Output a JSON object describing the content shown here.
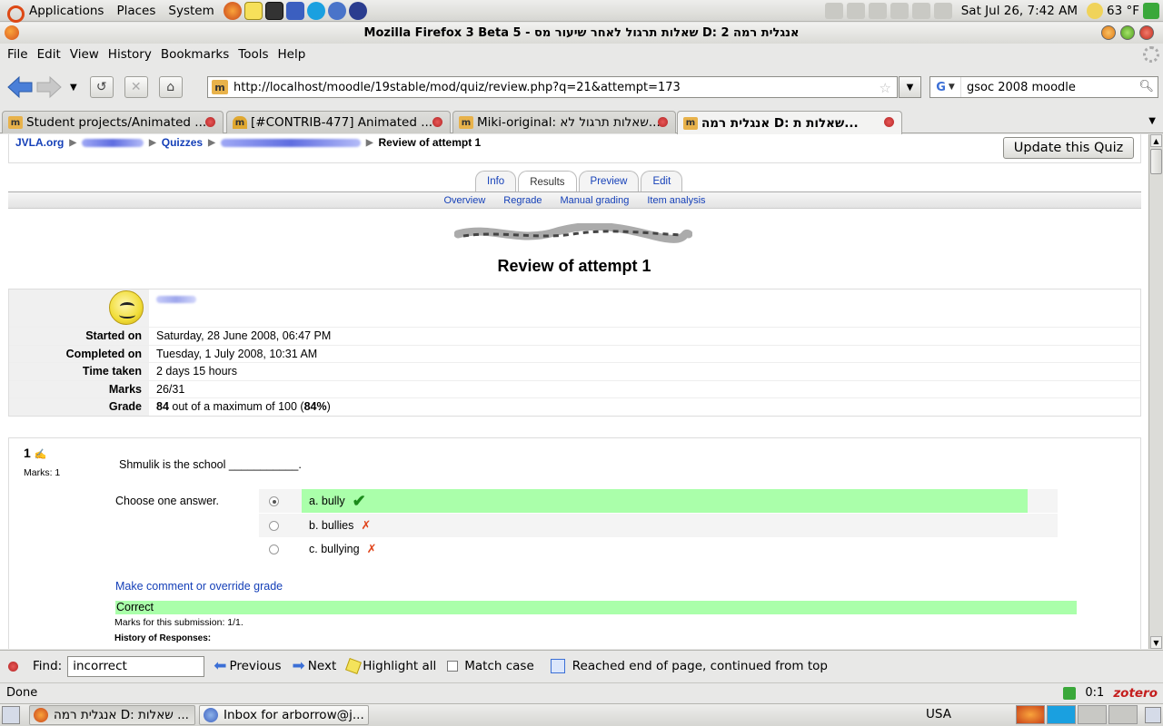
{
  "gnome_panel": {
    "menus": [
      "Applications",
      "Places",
      "System"
    ],
    "clock": "Sat Jul 26,  7:42 AM",
    "weather": "63 °F"
  },
  "window": {
    "title": "אנגלית רמה D: 2 שאלות תרגול לאחר שיעור מס - Mozilla Firefox 3 Beta 5"
  },
  "menubar": [
    "File",
    "Edit",
    "View",
    "History",
    "Bookmarks",
    "Tools",
    "Help"
  ],
  "navbar": {
    "url": "http://localhost/moodle/19stable/mod/quiz/review.php?q=21&attempt=173",
    "search_engine": "G",
    "search_text": "gsoc 2008 moodle"
  },
  "tabs": [
    {
      "label": "Student projects/Animated ..."
    },
    {
      "label": "[#CONTRIB-477] Animated ..."
    },
    {
      "label": "Miki-original: שאלות תרגול לא..."
    },
    {
      "label": "אנגלית רמה D: שאלות ת..."
    }
  ],
  "page": {
    "breadcrumb": {
      "home": "JVLA.org",
      "quizzes": "Quizzes",
      "current": "Review of attempt 1"
    },
    "update_button": "Update this Quiz",
    "quiz_tabs": [
      "Info",
      "Results",
      "Preview",
      "Edit"
    ],
    "quiz_subtabs": [
      "Overview",
      "Regrade",
      "Manual grading",
      "Item analysis"
    ],
    "title": "Review of attempt 1",
    "summary": {
      "started_label": "Started on",
      "started_value": "Saturday, 28 June 2008, 06:47 PM",
      "completed_label": "Completed on",
      "completed_value": "Tuesday, 1 July 2008, 10:31 AM",
      "time_label": "Time taken",
      "time_value": "2 days 15 hours",
      "marks_label": "Marks",
      "marks_value": "26/31",
      "grade_label": "Grade",
      "grade_score": "84",
      "grade_middle": " out of a maximum of 100 (",
      "grade_percent": "84%",
      "grade_end": ")"
    },
    "question": {
      "number": "1",
      "marks": "Marks: 1",
      "text": "Shmulik is the school ___________.",
      "prompt": "Choose one answer.",
      "answers": [
        {
          "text": "a. bully",
          "mark": "✔",
          "selected": true,
          "correct": true
        },
        {
          "text": "b. bullies",
          "mark": "✗",
          "selected": false,
          "correct": false
        },
        {
          "text": "c. bullying",
          "mark": "✗",
          "selected": false,
          "correct": false
        }
      ],
      "comment_link": "Make comment or override grade",
      "feedback": "Correct",
      "submission_marks": "Marks for this submission: 1/1.",
      "history_label": "History of Responses:"
    }
  },
  "findbar": {
    "label": "Find:",
    "query": "incorrect",
    "previous": "Previous",
    "next": "Next",
    "highlight": "Highlight all",
    "match_case": "Match case",
    "status": "Reached end of page, continued from top"
  },
  "statusbar": {
    "status": "Done",
    "counter": "0:1",
    "zotero": "zotero"
  },
  "taskbar": {
    "tasks": [
      "אנגלית רמה D: שאלות ...",
      "Inbox for arborrow@j..."
    ],
    "keyboard": "USA"
  },
  "colors": {
    "link": "#1540b8",
    "correct_bg": "#aaffaa",
    "wrong_mark": "#e0441b"
  }
}
